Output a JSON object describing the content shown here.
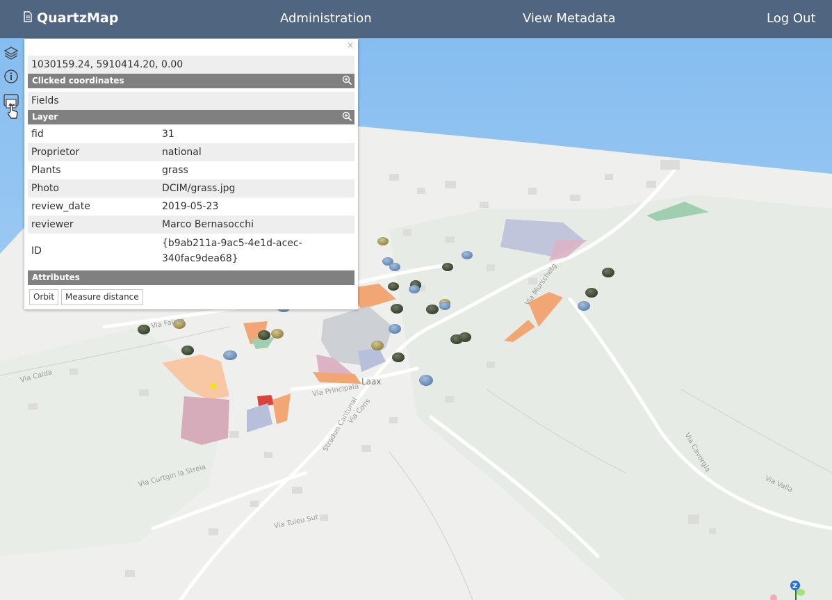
{
  "app": {
    "brand": "QuartzMap",
    "nav": [
      "Administration",
      "View Metadata",
      "Log Out"
    ]
  },
  "sidebar": {
    "tools": [
      "layers-icon",
      "info-icon",
      "print-icon"
    ]
  },
  "popup": {
    "coordinates": "1030159.24, 5910414.20, 0.00",
    "clicked_label": "Clicked coordinates",
    "fields_label": "Fields",
    "layer_label": "Layer",
    "attributes_label": "Attributes",
    "close_symbol": "×",
    "rows": [
      {
        "key": "fid",
        "value": "31"
      },
      {
        "key": "Proprietor",
        "value": "national"
      },
      {
        "key": "Plants",
        "value": "grass"
      },
      {
        "key": "Photo",
        "value": "DCIM/grass.jpg"
      },
      {
        "key": "review_date",
        "value": "2019-05-23"
      },
      {
        "key": "reviewer",
        "value": "Marco Bernasocchi"
      },
      {
        "key": "ID",
        "value": "{b9ab211a-9ac5-4e1d-acec-340fac9dea68}"
      }
    ],
    "buttons": [
      "Orbit",
      "Measure distance"
    ]
  },
  "map": {
    "labels": [
      "Laax",
      "Via Falera",
      "Via Principala",
      "Stradun Cantunal",
      "Via Murschetg",
      "Via Tuleu Sut",
      "Via Curtgin la Streia",
      "Via Valla",
      "Via Cons",
      "Via Cavorgia",
      "Via Calda"
    ],
    "compass": "Z"
  }
}
